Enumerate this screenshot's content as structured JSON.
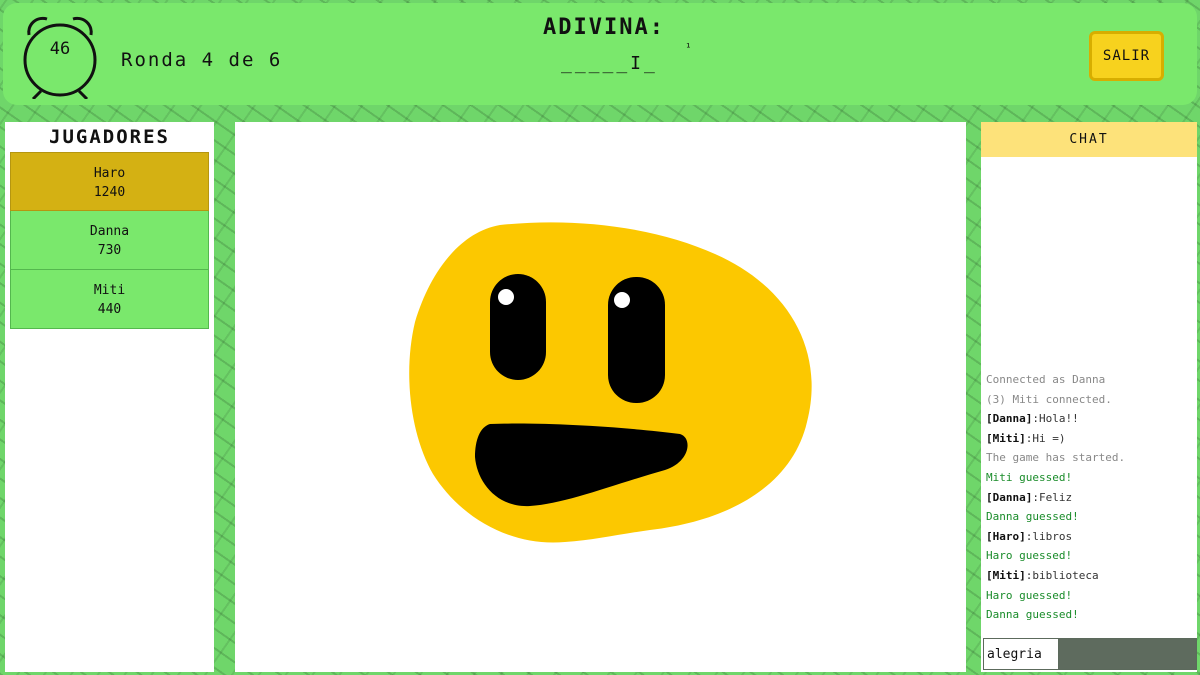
{
  "header": {
    "timer_value": "46",
    "round_label": "Ronda 4 de 6",
    "guess_title": "ADIVINA:",
    "word_hint": "_____I_",
    "hint_mark": "¹",
    "exit_label": "SALIR"
  },
  "players": {
    "title": "JUGADORES",
    "list": [
      {
        "name": "Haro",
        "score": "1240",
        "active": true
      },
      {
        "name": "Danna",
        "score": "730",
        "active": false
      },
      {
        "name": "Miti",
        "score": "440",
        "active": false
      }
    ]
  },
  "canvas": {
    "icon": "smiley-face-drawing",
    "face_color": "#fcc800",
    "feature_color": "#000000"
  },
  "chat": {
    "title": "CHAT",
    "messages": [
      {
        "type": "system",
        "name": "",
        "text": "Connected as Danna"
      },
      {
        "type": "system",
        "name": "",
        "text": "(3) Miti connected."
      },
      {
        "type": "user",
        "name": "[Danna]",
        "text": ":Hola!!"
      },
      {
        "type": "user",
        "name": "[Miti]",
        "text": ":Hi =)"
      },
      {
        "type": "system",
        "name": "",
        "text": "The game has started."
      },
      {
        "type": "guessed",
        "name": "",
        "text": "Miti guessed!"
      },
      {
        "type": "user",
        "name": "[Danna]",
        "text": ":Feliz"
      },
      {
        "type": "guessed",
        "name": "",
        "text": "Danna guessed!"
      },
      {
        "type": "user",
        "name": "[Haro]",
        "text": ":libros"
      },
      {
        "type": "guessed",
        "name": "",
        "text": "Haro guessed!"
      },
      {
        "type": "user",
        "name": "[Miti]",
        "text": ":biblioteca"
      },
      {
        "type": "guessed",
        "name": "",
        "text": "Haro guessed!"
      },
      {
        "type": "guessed",
        "name": "",
        "text": "Danna guessed!"
      }
    ],
    "input_value": "alegria"
  },
  "colors": {
    "accent_green": "#7ae86c",
    "active_player": "#d4b113",
    "exit_button": "#f7d21e",
    "chat_header": "#fde27a",
    "guessed_text": "#1a8c2a"
  }
}
